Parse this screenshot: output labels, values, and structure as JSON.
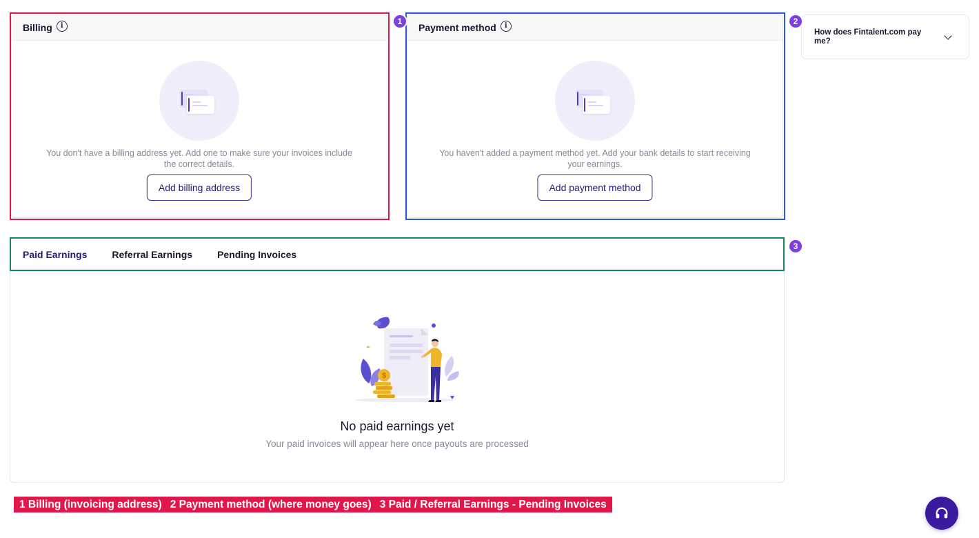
{
  "billing": {
    "title": "Billing",
    "empty_text": "You don't have a billing address yet. Add one to make sure your invoices include the correct details.",
    "button_label": "Add billing address"
  },
  "payment": {
    "title": "Payment method",
    "empty_text": "You haven't added a payment method yet. Add your bank details to start receiving your earnings.",
    "button_label": "Add payment method"
  },
  "faq": {
    "question": "How does Fintalent.com pay me?"
  },
  "earnings": {
    "tabs": [
      {
        "label": "Paid Earnings",
        "active": true
      },
      {
        "label": "Referral Earnings",
        "active": false
      },
      {
        "label": "Pending Invoices",
        "active": false
      }
    ],
    "empty_title": "No paid earnings yet",
    "empty_subtitle": "Your paid invoices will appear here once payouts are processed"
  },
  "annotations": {
    "badges": [
      "1",
      "2",
      "3"
    ],
    "legend": [
      "1 Billing (invoicing address)",
      "2 Payment method (where money goes)",
      "3 Paid / Referral Earnings - Pending Invoices"
    ],
    "colors": {
      "billing_box": "#e0174a",
      "payment_box": "#2a5bd7",
      "tabs_box": "#15875a",
      "badge": "#7b3fe4",
      "legend_bg": "#e0174a"
    }
  },
  "icons": {
    "info": "info-icon",
    "chevron": "chevron-down-icon",
    "help": "headset-icon",
    "empty_docs": "documents-icon"
  },
  "help_button": {
    "icon": "headset-icon"
  }
}
